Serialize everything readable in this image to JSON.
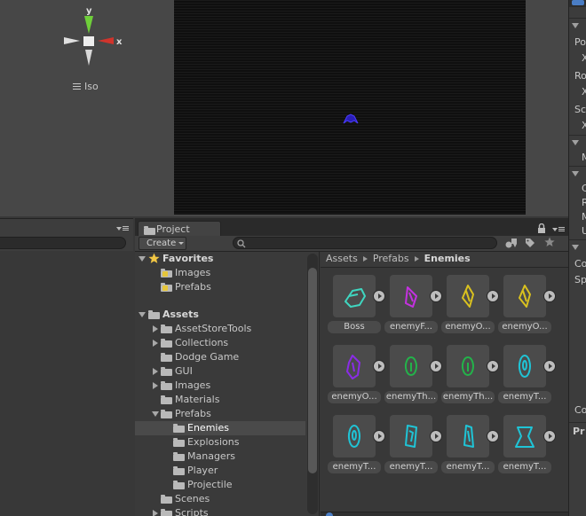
{
  "scene_view": {
    "gizmo": {
      "x_axis": "x",
      "y_axis": "y"
    },
    "projection_label": "Iso"
  },
  "inspector": {
    "rows": [
      "Po",
      "X",
      "Ro",
      "X",
      "Sc",
      "X",
      "M",
      "C",
      "R",
      "M",
      "U",
      "Co",
      "Sp",
      "Co",
      "Pr"
    ]
  },
  "project_window": {
    "tab_label": "Project",
    "create_label": "Create",
    "search": {
      "value": "",
      "placeholder": ""
    },
    "tree": {
      "favorites": {
        "label": "Favorites",
        "items": [
          "Images",
          "Prefabs"
        ]
      },
      "assets": {
        "label": "Assets",
        "items": [
          "AssetStoreTools",
          "Collections",
          "Dodge Game",
          "GUI",
          "Images",
          "Materials",
          "Prefabs",
          "Scenes",
          "Scripts"
        ],
        "prefabs_children": [
          "Enemies",
          "Explosions",
          "Managers",
          "Player",
          "Projectile"
        ],
        "selected": "Enemies"
      }
    },
    "breadcrumb": [
      "Assets",
      "Prefabs",
      "Enemies"
    ],
    "assets": [
      {
        "name": "Boss",
        "color": "#3fd6c0"
      },
      {
        "name": "enemyF...",
        "color": "#c431e0"
      },
      {
        "name": "enemyO...",
        "color": "#d9c11f"
      },
      {
        "name": "enemyO...",
        "color": "#d9c11f"
      },
      {
        "name": "enemyO...",
        "color": "#8a2ce6"
      },
      {
        "name": "enemyTh...",
        "color": "#23b34a"
      },
      {
        "name": "enemyTh...",
        "color": "#23b34a"
      },
      {
        "name": "enemyT...",
        "color": "#1fc4d6"
      },
      {
        "name": "enemyT...",
        "color": "#1fc4d6"
      },
      {
        "name": "enemyT...",
        "color": "#1fc4d6"
      },
      {
        "name": "enemyT...",
        "color": "#1fc4d6"
      },
      {
        "name": "enemyT...",
        "color": "#1fc4d6"
      }
    ]
  },
  "colors": {
    "gizmo_x": "#d0342c",
    "gizmo_y": "#6fcf3a",
    "ship": "#3322cc",
    "favorites_star": "#f2c744"
  }
}
